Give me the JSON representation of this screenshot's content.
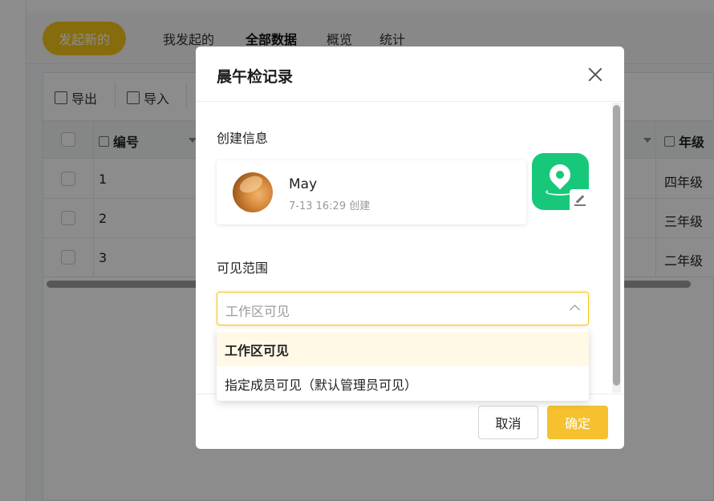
{
  "page": {
    "new_button": "发起新的",
    "tabs": [
      {
        "label": "我发起的"
      },
      {
        "label": "全部数据"
      },
      {
        "label": "概览"
      },
      {
        "label": "统计"
      }
    ],
    "toolbar": {
      "export_label": "导出",
      "import_label": "导入"
    },
    "table": {
      "columns": [
        {
          "label": "编号"
        },
        {
          "label": "年级"
        }
      ],
      "rows": [
        {
          "num": "1",
          "grade": "四年级"
        },
        {
          "num": "2",
          "grade": "三年级"
        },
        {
          "num": "3",
          "grade": "二年级"
        }
      ]
    }
  },
  "dialog": {
    "title": "晨午检记录",
    "creator_section_label": "创建信息",
    "creator": {
      "name": "May",
      "meta": "7-13 16:29 创建"
    },
    "visibility_label": "可见范围",
    "select_value": "工作区可见",
    "options": [
      {
        "label": "工作区可见",
        "selected": true
      },
      {
        "label": "指定成员可见（默认管理员可见）",
        "selected": false
      }
    ],
    "cancel_label": "取消",
    "confirm_label": "确定"
  },
  "colors": {
    "accent": "#f5c518",
    "app_icon": "#17c87a",
    "overlay": "rgba(0,0,0,0.45)"
  },
  "icons": {
    "export": "export-icon",
    "import": "import-icon",
    "close": "close-icon",
    "app": "location-pin-icon",
    "edit": "edit-icon",
    "chevron": "chevron-up-icon"
  }
}
